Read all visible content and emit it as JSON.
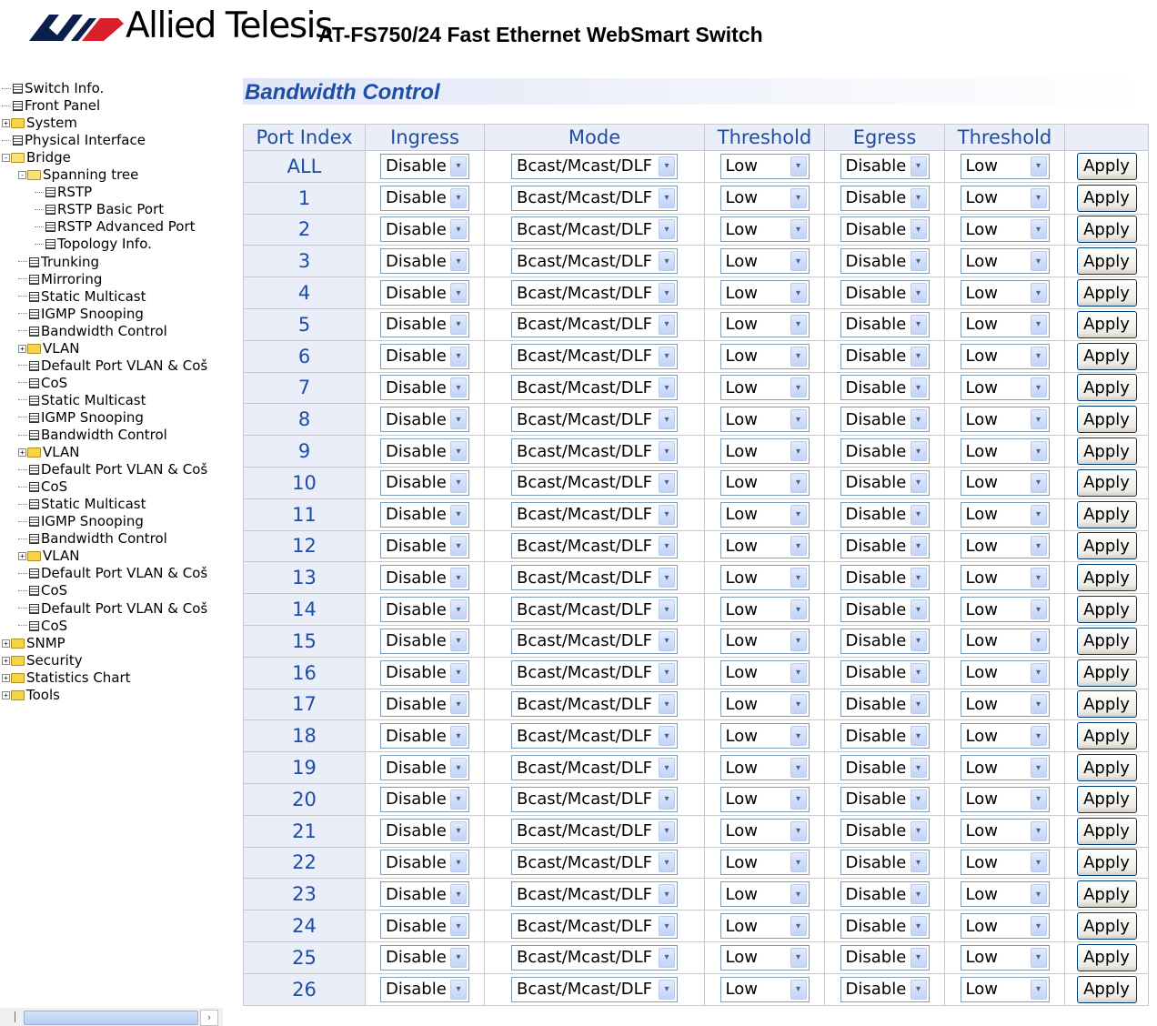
{
  "header": {
    "brand_name": "Allied Telesis",
    "product_name": "AT-FS750/24 Fast Ethernet WebSmart Switch"
  },
  "nav": {
    "items": [
      {
        "label": "Switch Info.",
        "icon": "page-icon",
        "level": 0,
        "expander": ""
      },
      {
        "label": "Front Panel",
        "icon": "page-icon",
        "level": 0,
        "expander": ""
      },
      {
        "label": "System",
        "icon": "folder-icon",
        "level": 0,
        "expander": "+"
      },
      {
        "label": "Physical Interface",
        "icon": "page-icon",
        "level": 0,
        "expander": ""
      },
      {
        "label": "Bridge",
        "icon": "folder-open-icon",
        "level": 0,
        "expander": "-"
      },
      {
        "label": "Spanning tree",
        "icon": "folder-open-icon",
        "level": 1,
        "expander": "-"
      },
      {
        "label": "RSTP",
        "icon": "page-icon",
        "level": 2,
        "expander": ""
      },
      {
        "label": "RSTP Basic Port",
        "icon": "page-icon",
        "level": 2,
        "expander": ""
      },
      {
        "label": "RSTP Advanced Port",
        "icon": "page-icon",
        "level": 2,
        "expander": ""
      },
      {
        "label": "Topology Info.",
        "icon": "page-icon",
        "level": 2,
        "expander": ""
      },
      {
        "label": "Trunking",
        "icon": "page-icon",
        "level": 1,
        "expander": ""
      },
      {
        "label": "Mirroring",
        "icon": "page-icon",
        "level": 1,
        "expander": ""
      },
      {
        "label": "Static Multicast",
        "icon": "page-icon",
        "level": 1,
        "expander": ""
      },
      {
        "label": "IGMP Snooping",
        "icon": "page-icon",
        "level": 1,
        "expander": ""
      },
      {
        "label": "Bandwidth Control",
        "icon": "page-icon",
        "level": 1,
        "expander": ""
      },
      {
        "label": "VLAN",
        "icon": "folder-icon",
        "level": 1,
        "expander": "+"
      },
      {
        "label": "Default Port VLAN & Coš",
        "icon": "page-icon",
        "level": 1,
        "expander": ""
      },
      {
        "label": "CoS",
        "icon": "page-icon",
        "level": 1,
        "expander": ""
      },
      {
        "label": "Static Multicast",
        "icon": "page-icon",
        "level": 1,
        "expander": ""
      },
      {
        "label": "IGMP Snooping",
        "icon": "page-icon",
        "level": 1,
        "expander": ""
      },
      {
        "label": "Bandwidth Control",
        "icon": "page-icon",
        "level": 1,
        "expander": ""
      },
      {
        "label": "VLAN",
        "icon": "folder-icon",
        "level": 1,
        "expander": "+"
      },
      {
        "label": "Default Port VLAN & Coš",
        "icon": "page-icon",
        "level": 1,
        "expander": ""
      },
      {
        "label": "CoS",
        "icon": "page-icon",
        "level": 1,
        "expander": ""
      },
      {
        "label": "Static Multicast",
        "icon": "page-icon",
        "level": 1,
        "expander": ""
      },
      {
        "label": "IGMP Snooping",
        "icon": "page-icon",
        "level": 1,
        "expander": ""
      },
      {
        "label": "Bandwidth Control",
        "icon": "page-icon",
        "level": 1,
        "expander": ""
      },
      {
        "label": "VLAN",
        "icon": "folder-icon",
        "level": 1,
        "expander": "+"
      },
      {
        "label": "Default Port VLAN & Coš",
        "icon": "page-icon",
        "level": 1,
        "expander": ""
      },
      {
        "label": "CoS",
        "icon": "page-icon",
        "level": 1,
        "expander": ""
      },
      {
        "label": "Default Port VLAN & Coš",
        "icon": "page-icon",
        "level": 1,
        "expander": ""
      },
      {
        "label": "CoS",
        "icon": "page-icon",
        "level": 1,
        "expander": ""
      },
      {
        "label": "SNMP",
        "icon": "folder-icon",
        "level": 0,
        "expander": "+"
      },
      {
        "label": "Security",
        "icon": "folder-icon",
        "level": 0,
        "expander": "+"
      },
      {
        "label": "Statistics Chart",
        "icon": "folder-icon",
        "level": 0,
        "expander": "+"
      },
      {
        "label": "Tools",
        "icon": "folder-icon",
        "level": 0,
        "expander": "+"
      }
    ]
  },
  "main": {
    "title": "Bandwidth Control",
    "columns": [
      "Port Index",
      "Ingress",
      "Mode",
      "Threshold",
      "Egress",
      "Threshold",
      ""
    ],
    "apply_label": "Apply",
    "rows": [
      {
        "port": "ALL",
        "ingress": "Disable",
        "mode": "Bcast/Mcast/DLF",
        "ingress_threshold": "Low",
        "egress": "Disable",
        "egress_threshold": "Low"
      },
      {
        "port": "1",
        "ingress": "Disable",
        "mode": "Bcast/Mcast/DLF",
        "ingress_threshold": "Low",
        "egress": "Disable",
        "egress_threshold": "Low"
      },
      {
        "port": "2",
        "ingress": "Disable",
        "mode": "Bcast/Mcast/DLF",
        "ingress_threshold": "Low",
        "egress": "Disable",
        "egress_threshold": "Low"
      },
      {
        "port": "3",
        "ingress": "Disable",
        "mode": "Bcast/Mcast/DLF",
        "ingress_threshold": "Low",
        "egress": "Disable",
        "egress_threshold": "Low"
      },
      {
        "port": "4",
        "ingress": "Disable",
        "mode": "Bcast/Mcast/DLF",
        "ingress_threshold": "Low",
        "egress": "Disable",
        "egress_threshold": "Low"
      },
      {
        "port": "5",
        "ingress": "Disable",
        "mode": "Bcast/Mcast/DLF",
        "ingress_threshold": "Low",
        "egress": "Disable",
        "egress_threshold": "Low"
      },
      {
        "port": "6",
        "ingress": "Disable",
        "mode": "Bcast/Mcast/DLF",
        "ingress_threshold": "Low",
        "egress": "Disable",
        "egress_threshold": "Low"
      },
      {
        "port": "7",
        "ingress": "Disable",
        "mode": "Bcast/Mcast/DLF",
        "ingress_threshold": "Low",
        "egress": "Disable",
        "egress_threshold": "Low"
      },
      {
        "port": "8",
        "ingress": "Disable",
        "mode": "Bcast/Mcast/DLF",
        "ingress_threshold": "Low",
        "egress": "Disable",
        "egress_threshold": "Low"
      },
      {
        "port": "9",
        "ingress": "Disable",
        "mode": "Bcast/Mcast/DLF",
        "ingress_threshold": "Low",
        "egress": "Disable",
        "egress_threshold": "Low"
      },
      {
        "port": "10",
        "ingress": "Disable",
        "mode": "Bcast/Mcast/DLF",
        "ingress_threshold": "Low",
        "egress": "Disable",
        "egress_threshold": "Low"
      },
      {
        "port": "11",
        "ingress": "Disable",
        "mode": "Bcast/Mcast/DLF",
        "ingress_threshold": "Low",
        "egress": "Disable",
        "egress_threshold": "Low"
      },
      {
        "port": "12",
        "ingress": "Disable",
        "mode": "Bcast/Mcast/DLF",
        "ingress_threshold": "Low",
        "egress": "Disable",
        "egress_threshold": "Low"
      },
      {
        "port": "13",
        "ingress": "Disable",
        "mode": "Bcast/Mcast/DLF",
        "ingress_threshold": "Low",
        "egress": "Disable",
        "egress_threshold": "Low"
      },
      {
        "port": "14",
        "ingress": "Disable",
        "mode": "Bcast/Mcast/DLF",
        "ingress_threshold": "Low",
        "egress": "Disable",
        "egress_threshold": "Low"
      },
      {
        "port": "15",
        "ingress": "Disable",
        "mode": "Bcast/Mcast/DLF",
        "ingress_threshold": "Low",
        "egress": "Disable",
        "egress_threshold": "Low"
      },
      {
        "port": "16",
        "ingress": "Disable",
        "mode": "Bcast/Mcast/DLF",
        "ingress_threshold": "Low",
        "egress": "Disable",
        "egress_threshold": "Low"
      },
      {
        "port": "17",
        "ingress": "Disable",
        "mode": "Bcast/Mcast/DLF",
        "ingress_threshold": "Low",
        "egress": "Disable",
        "egress_threshold": "Low"
      },
      {
        "port": "18",
        "ingress": "Disable",
        "mode": "Bcast/Mcast/DLF",
        "ingress_threshold": "Low",
        "egress": "Disable",
        "egress_threshold": "Low"
      },
      {
        "port": "19",
        "ingress": "Disable",
        "mode": "Bcast/Mcast/DLF",
        "ingress_threshold": "Low",
        "egress": "Disable",
        "egress_threshold": "Low"
      },
      {
        "port": "20",
        "ingress": "Disable",
        "mode": "Bcast/Mcast/DLF",
        "ingress_threshold": "Low",
        "egress": "Disable",
        "egress_threshold": "Low"
      },
      {
        "port": "21",
        "ingress": "Disable",
        "mode": "Bcast/Mcast/DLF",
        "ingress_threshold": "Low",
        "egress": "Disable",
        "egress_threshold": "Low"
      },
      {
        "port": "22",
        "ingress": "Disable",
        "mode": "Bcast/Mcast/DLF",
        "ingress_threshold": "Low",
        "egress": "Disable",
        "egress_threshold": "Low"
      },
      {
        "port": "23",
        "ingress": "Disable",
        "mode": "Bcast/Mcast/DLF",
        "ingress_threshold": "Low",
        "egress": "Disable",
        "egress_threshold": "Low"
      },
      {
        "port": "24",
        "ingress": "Disable",
        "mode": "Bcast/Mcast/DLF",
        "ingress_threshold": "Low",
        "egress": "Disable",
        "egress_threshold": "Low"
      },
      {
        "port": "25",
        "ingress": "Disable",
        "mode": "Bcast/Mcast/DLF",
        "ingress_threshold": "Low",
        "egress": "Disable",
        "egress_threshold": "Low"
      },
      {
        "port": "26",
        "ingress": "Disable",
        "mode": "Bcast/Mcast/DLF",
        "ingress_threshold": "Low",
        "egress": "Disable",
        "egress_threshold": "Low"
      }
    ]
  },
  "colors": {
    "accent_blue": "#1f4da6",
    "header_cell_bg": "#e9eef9",
    "logo_red": "#d8202a",
    "logo_navy": "#0b1f4a"
  }
}
